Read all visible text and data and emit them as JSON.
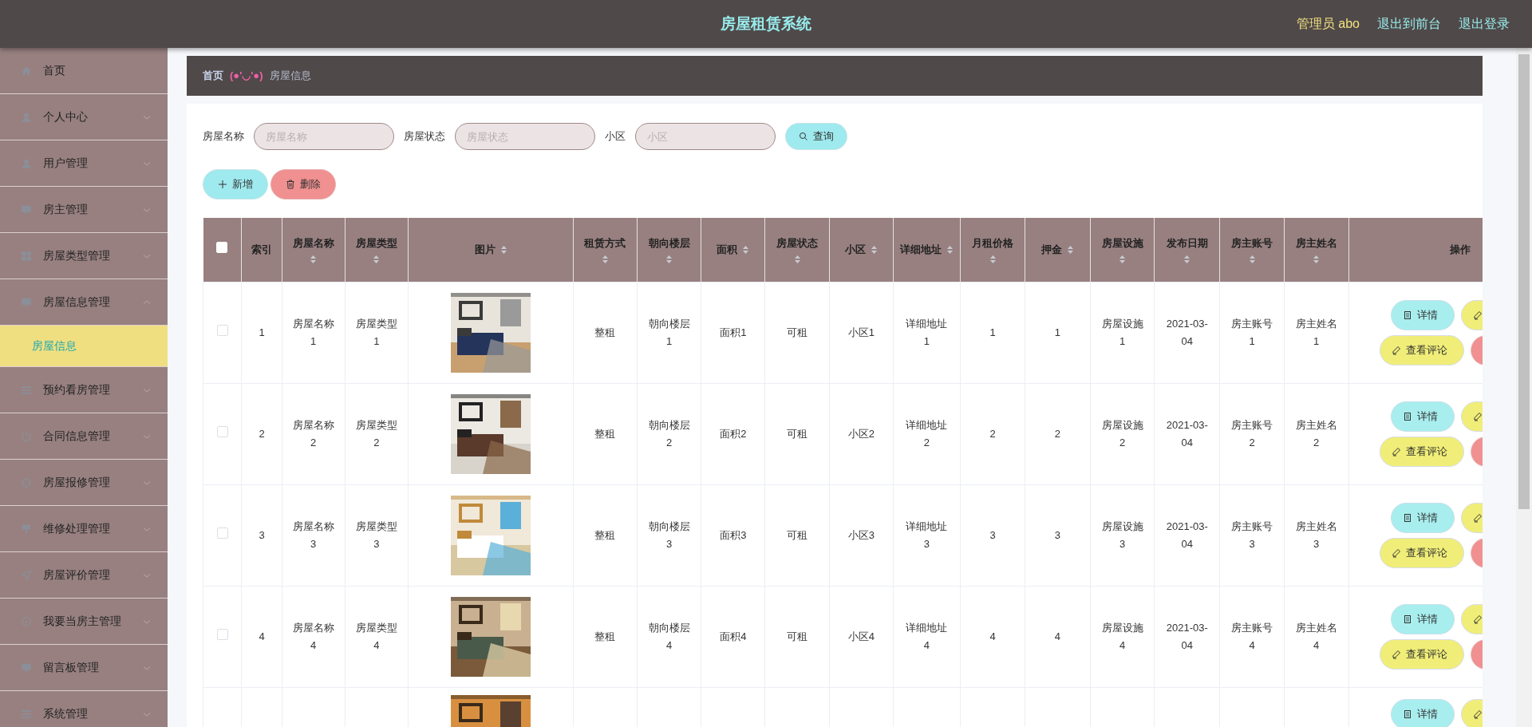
{
  "header": {
    "title": "房屋租赁系统",
    "user": "管理员 abo",
    "links": [
      "退出到前台",
      "退出登录"
    ]
  },
  "sidebar": {
    "items": [
      {
        "kind": "link",
        "label": "首页"
      },
      {
        "kind": "menu",
        "label": "个人中心",
        "expanded": false
      },
      {
        "kind": "menu",
        "label": "用户管理",
        "expanded": false
      },
      {
        "kind": "menu",
        "label": "房主管理",
        "expanded": false
      },
      {
        "kind": "menu",
        "label": "房屋类型管理",
        "expanded": false
      },
      {
        "kind": "menu",
        "label": "房屋信息管理",
        "expanded": true,
        "children": [
          {
            "label": "房屋信息",
            "selected": true
          }
        ]
      },
      {
        "kind": "menu",
        "label": "预约看房管理",
        "expanded": false
      },
      {
        "kind": "menu",
        "label": "合同信息管理",
        "expanded": false
      },
      {
        "kind": "menu",
        "label": "房屋报修管理",
        "expanded": false
      },
      {
        "kind": "menu",
        "label": "维修处理管理",
        "expanded": false
      },
      {
        "kind": "menu",
        "label": "房屋评价管理",
        "expanded": false
      },
      {
        "kind": "menu",
        "label": "我要当房主管理",
        "expanded": false
      },
      {
        "kind": "menu",
        "label": "留言板管理",
        "expanded": false
      },
      {
        "kind": "menu",
        "label": "系统管理",
        "expanded": false
      }
    ]
  },
  "breadcrumb": {
    "home": "首页",
    "separator": "(●'◡'●)",
    "current": "房屋信息"
  },
  "search": {
    "fields": [
      {
        "label": "房屋名称",
        "placeholder": "房屋名称"
      },
      {
        "label": "房屋状态",
        "placeholder": "房屋状态"
      },
      {
        "label": "小区",
        "placeholder": "小区"
      }
    ],
    "button": "查询"
  },
  "toolbar": {
    "add": "新增",
    "delete": "删除"
  },
  "table": {
    "header_checked": false,
    "columns": [
      {
        "kind": "text",
        "label": "索引",
        "sortable": false
      },
      {
        "kind": "text",
        "label": "房屋名称",
        "sortable": true
      },
      {
        "kind": "text",
        "label": "房屋类型",
        "sortable": true
      },
      {
        "label": "图片",
        "sortable": true
      },
      {
        "kind": "text",
        "label": "租赁方式",
        "sortable": true
      },
      {
        "kind": "text",
        "label": "朝向楼层",
        "sortable": true
      },
      {
        "kind": "text",
        "label": "面积",
        "sortable": true
      },
      {
        "kind": "text",
        "label": "房屋状态",
        "sortable": true
      },
      {
        "kind": "text",
        "label": "小区",
        "sortable": true
      },
      {
        "kind": "text",
        "label": "详细地址",
        "sortable": true
      },
      {
        "kind": "text",
        "label": "月租价格",
        "sortable": true
      },
      {
        "kind": "text",
        "label": "押金",
        "sortable": true
      },
      {
        "kind": "text",
        "label": "房屋设施",
        "sortable": true
      },
      {
        "kind": "text",
        "label": "发布日期",
        "sortable": true
      },
      {
        "kind": "text",
        "label": "房主账号",
        "sortable": true
      },
      {
        "kind": "text",
        "label": "房主姓名",
        "sortable": true
      },
      {
        "kind": "actions",
        "label": "操作",
        "sortable": false
      }
    ],
    "rows": [
      {
        "checked": false,
        "cells": [
          "1",
          "房屋名称1",
          "房屋类型1",
          "",
          "整租",
          "朝向楼层1",
          "面积1",
          "可租",
          "小区1",
          "详细地址1",
          "1",
          "1",
          "房屋设施1",
          "2021-03-04",
          "房主账号1",
          "房主姓名1"
        ],
        "actions": [
          {
            "kind": "detail",
            "label": "详情"
          },
          {
            "kind": "edit"
          },
          {
            "kind": "comment",
            "label": "查看评论"
          },
          {
            "kind": "delete"
          }
        ]
      },
      {
        "checked": false,
        "cells": [
          "2",
          "房屋名称2",
          "房屋类型2",
          "",
          "整租",
          "朝向楼层2",
          "面积2",
          "可租",
          "小区2",
          "详细地址2",
          "2",
          "2",
          "房屋设施2",
          "2021-03-04",
          "房主账号2",
          "房主姓名2"
        ],
        "actions": [
          {
            "kind": "detail",
            "label": "详情"
          },
          {
            "kind": "edit"
          },
          {
            "kind": "comment",
            "label": "查看评论"
          },
          {
            "kind": "delete"
          }
        ]
      },
      {
        "checked": false,
        "cells": [
          "3",
          "房屋名称3",
          "房屋类型3",
          "",
          "整租",
          "朝向楼层3",
          "面积3",
          "可租",
          "小区3",
          "详细地址3",
          "3",
          "3",
          "房屋设施3",
          "2021-03-04",
          "房主账号3",
          "房主姓名3"
        ],
        "actions": [
          {
            "kind": "detail",
            "label": "详情"
          },
          {
            "kind": "edit"
          },
          {
            "kind": "comment",
            "label": "查看评论"
          },
          {
            "kind": "delete"
          }
        ]
      },
      {
        "checked": false,
        "cells": [
          "4",
          "房屋名称4",
          "房屋类型4",
          "",
          "整租",
          "朝向楼层4",
          "面积4",
          "可租",
          "小区4",
          "详细地址4",
          "4",
          "4",
          "房屋设施4",
          "2021-03-04",
          "房主账号4",
          "房主姓名4"
        ],
        "actions": [
          {
            "kind": "detail",
            "label": "详情"
          },
          {
            "kind": "edit"
          },
          {
            "kind": "comment",
            "label": "查看评论"
          },
          {
            "kind": "delete"
          }
        ]
      },
      {
        "cells": [],
        "actions": [
          {
            "kind": "detail",
            "label": "详情"
          },
          {
            "kind": "edit"
          }
        ]
      }
    ]
  }
}
